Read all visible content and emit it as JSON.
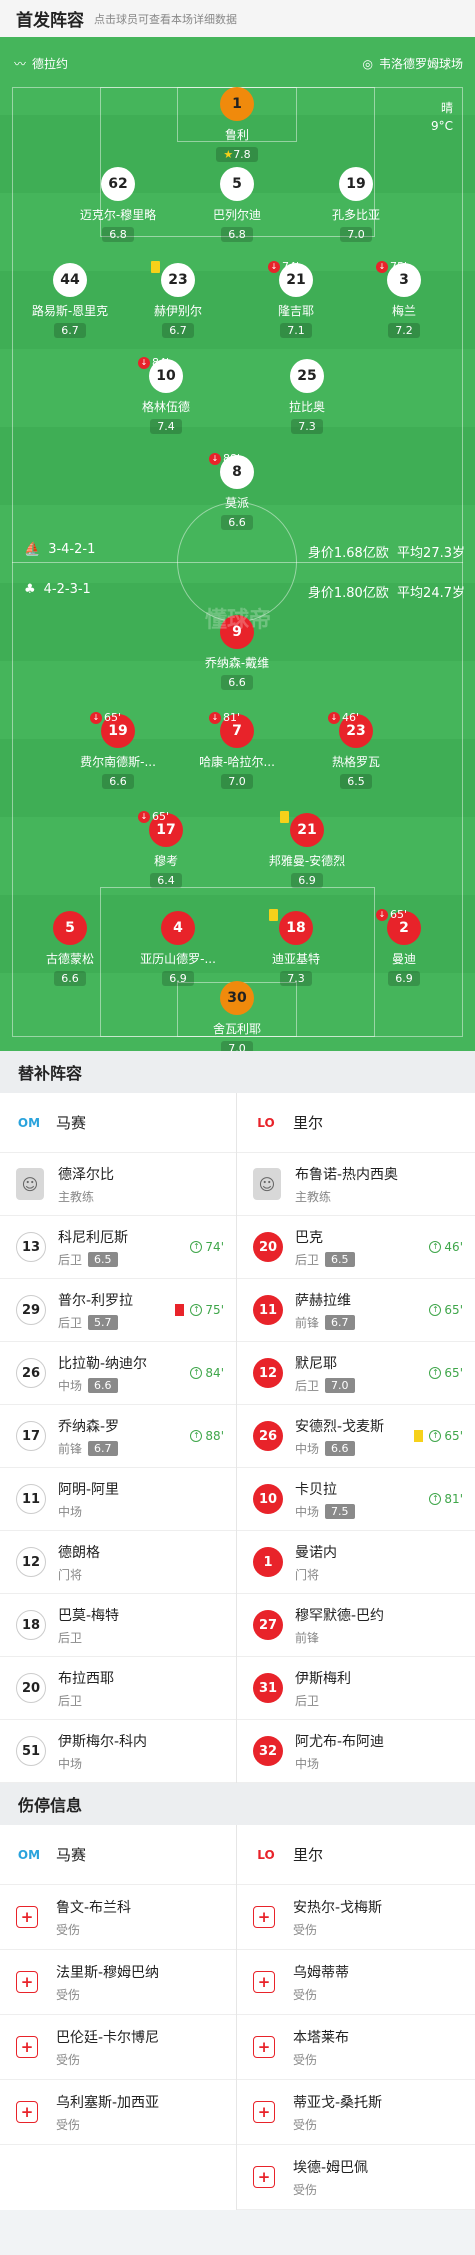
{
  "header": {
    "title": "首发阵容",
    "subtitle": "点击球员可查看本场详细数据"
  },
  "match": {
    "home_team_short": "德拉约",
    "venue": "韦洛德罗姆球场",
    "weather": "晴",
    "temperature": "9°C"
  },
  "home": {
    "formation": "3-4-2-1",
    "value": "身价1.68亿欧",
    "age": "平均27.3岁"
  },
  "away": {
    "formation": "4-2-3-1",
    "value": "身价1.80亿欧",
    "age": "平均24.7岁"
  },
  "watermark": "懂球帝",
  "home_players": [
    {
      "num": "1",
      "name": "鲁利",
      "rating": "7.8",
      "star": "★",
      "color": "o"
    },
    {
      "num": "62",
      "name": "迈克尔-穆里略",
      "rating": "6.8",
      "color": "w"
    },
    {
      "num": "5",
      "name": "巴列尔迪",
      "rating": "6.8",
      "color": "w",
      "cap": "C"
    },
    {
      "num": "19",
      "name": "孔多比亚",
      "rating": "7.0",
      "color": "w"
    },
    {
      "num": "44",
      "name": "路易斯-恩里克",
      "rating": "6.7",
      "color": "w"
    },
    {
      "num": "23",
      "name": "赫伊别尔",
      "rating": "6.7",
      "color": "w",
      "yellow": true
    },
    {
      "num": "21",
      "name": "隆吉耶",
      "rating": "7.1",
      "color": "w",
      "sub": "74'"
    },
    {
      "num": "3",
      "name": "梅兰",
      "rating": "7.2",
      "color": "w",
      "sub": "75'",
      "goal": "⚽"
    },
    {
      "num": "10",
      "name": "格林伍德",
      "rating": "7.4",
      "color": "w",
      "sub": "84'"
    },
    {
      "num": "25",
      "name": "拉比奥",
      "rating": "7.3",
      "color": "w",
      "goal": "⚽"
    },
    {
      "num": "8",
      "name": "莫派",
      "rating": "6.6",
      "color": "w",
      "sub": "88'"
    }
  ],
  "away_players": [
    {
      "num": "9",
      "name": "乔纳森-戴维",
      "rating": "6.6",
      "color": "r"
    },
    {
      "num": "19",
      "name": "费尔南德斯-...",
      "rating": "6.6",
      "color": "r",
      "sub": "65'"
    },
    {
      "num": "7",
      "name": "哈康-哈拉尔...",
      "rating": "7.0",
      "color": "r",
      "sub": "81'"
    },
    {
      "num": "23",
      "name": "热格罗瓦",
      "rating": "6.5",
      "color": "r",
      "sub": "46'"
    },
    {
      "num": "17",
      "name": "穆考",
      "rating": "6.4",
      "color": "r",
      "sub": "65'"
    },
    {
      "num": "21",
      "name": "邦雅曼-安德烈",
      "rating": "6.9",
      "color": "r",
      "cap": "C",
      "yellow": true
    },
    {
      "num": "5",
      "name": "古德蒙松",
      "rating": "6.6",
      "color": "r"
    },
    {
      "num": "4",
      "name": "亚历山德罗-...",
      "rating": "6.9",
      "color": "r"
    },
    {
      "num": "18",
      "name": "迪亚基特",
      "rating": "7.3",
      "color": "r",
      "yellow": true,
      "goal": "⚽"
    },
    {
      "num": "2",
      "name": "曼迪",
      "rating": "6.9",
      "color": "r",
      "sub": "65'"
    },
    {
      "num": "30",
      "name": "舍瓦利耶",
      "rating": "7.0",
      "color": "o"
    }
  ],
  "subs_title": "替补阵容",
  "injury_title": "伤停信息",
  "teams": {
    "home": "马赛",
    "away": "里尔"
  },
  "subs_home": [
    {
      "coach": true,
      "name": "德泽尔比",
      "pos": "主教练"
    },
    {
      "num": "13",
      "name": "科尼利厄斯",
      "pos": "后卫",
      "rating": "6.5",
      "sub": "74'"
    },
    {
      "num": "29",
      "name": "普尔-利罗拉",
      "pos": "后卫",
      "rating": "5.7",
      "sub": "75'",
      "red": true
    },
    {
      "num": "26",
      "name": "比拉勒-纳迪尔",
      "pos": "中场",
      "rating": "6.6",
      "sub": "84'"
    },
    {
      "num": "17",
      "name": "乔纳森-罗",
      "pos": "前锋",
      "rating": "6.7",
      "sub": "88'"
    },
    {
      "num": "11",
      "name": "阿明-阿里",
      "pos": "中场"
    },
    {
      "num": "12",
      "name": "德朗格",
      "pos": "门将"
    },
    {
      "num": "18",
      "name": "巴莫-梅特",
      "pos": "后卫"
    },
    {
      "num": "20",
      "name": "布拉西耶",
      "pos": "后卫"
    },
    {
      "num": "51",
      "name": "伊斯梅尔-科内",
      "pos": "中场"
    }
  ],
  "subs_away": [
    {
      "coach": true,
      "name": "布鲁诺-热内西奥",
      "pos": "主教练"
    },
    {
      "num": "20",
      "name": "巴克",
      "pos": "后卫",
      "rating": "6.5",
      "sub": "46'"
    },
    {
      "num": "11",
      "name": "萨赫拉维",
      "pos": "前锋",
      "rating": "6.7",
      "sub": "65'"
    },
    {
      "num": "12",
      "name": "默尼耶",
      "pos": "后卫",
      "rating": "7.0",
      "sub": "65'"
    },
    {
      "num": "26",
      "name": "安德烈-戈麦斯",
      "pos": "中场",
      "rating": "6.6",
      "sub": "65'",
      "yellow": true
    },
    {
      "num": "10",
      "name": "卡贝拉",
      "pos": "中场",
      "rating": "7.5",
      "sub": "81'"
    },
    {
      "num": "1",
      "name": "曼诺内",
      "pos": "门将"
    },
    {
      "num": "27",
      "name": "穆罕默德-巴约",
      "pos": "前锋"
    },
    {
      "num": "31",
      "name": "伊斯梅利",
      "pos": "后卫"
    },
    {
      "num": "32",
      "name": "阿尤布-布阿迪",
      "pos": "中场"
    }
  ],
  "injury_home": [
    {
      "name": "鲁文-布兰科",
      "status": "受伤"
    },
    {
      "name": "法里斯-穆姆巴纳",
      "status": "受伤"
    },
    {
      "name": "巴伦廷-卡尔博尼",
      "status": "受伤"
    },
    {
      "name": "乌利塞斯-加西亚",
      "status": "受伤"
    }
  ],
  "injury_away": [
    {
      "name": "安热尔-戈梅斯",
      "status": "受伤"
    },
    {
      "name": "乌姆蒂蒂",
      "status": "受伤"
    },
    {
      "name": "本塔莱布",
      "status": "受伤"
    },
    {
      "name": "蒂亚戈-桑托斯",
      "status": "受伤"
    },
    {
      "name": "埃德-姆巴佩",
      "status": "受伤"
    }
  ],
  "colors": {
    "pitch": "#3fae55",
    "home_team": "#ffffff",
    "away_team": "#e8232a",
    "keeper_home": "#f08a0c"
  }
}
